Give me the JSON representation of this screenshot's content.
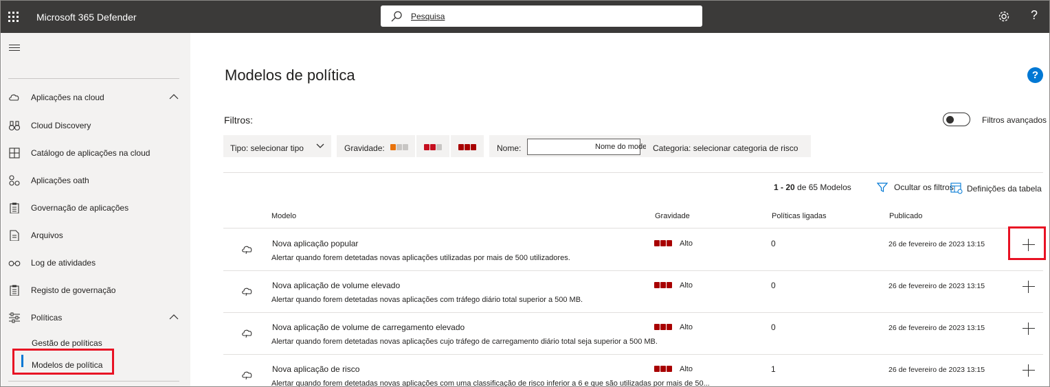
{
  "app": {
    "title": "Microsoft 365 Defender",
    "search_placeholder": "Pesquisa"
  },
  "sidebar": {
    "items": [
      {
        "label": "Aplicações na cloud",
        "icon": "cloud-icon"
      },
      {
        "label": "Cloud Discovery",
        "icon": "binoculars-icon"
      },
      {
        "label": "Catálogo de aplicações na cloud",
        "icon": "catalog-icon"
      },
      {
        "label": "Aplicações oath",
        "icon": "oauth-apps-icon"
      },
      {
        "label": "Governação de aplicações",
        "icon": "clipboard-icon"
      },
      {
        "label": "Arquivos",
        "icon": "document-icon"
      },
      {
        "label": "Log de atividades",
        "icon": "glasses-icon"
      },
      {
        "label": "Registo de governação",
        "icon": "clipboard-icon"
      },
      {
        "label": "Políticas",
        "icon": "sliders-icon"
      }
    ],
    "sub_items": [
      {
        "label": "Gestão de políticas"
      },
      {
        "label": "Modelos de política"
      }
    ]
  },
  "main": {
    "title": "Modelos de política",
    "filters_label": "Filtros:",
    "advanced_filters_label": "Filtros avançados",
    "filter_type": "Tipo: selecionar tipo",
    "filter_severity": "Gravidade:",
    "filter_name": "Nome:",
    "filter_name_placeholder": "Nome do modelo",
    "filter_category": "Categoria: selecionar categoria de risco",
    "count_range": "1 - 20",
    "count_suffix": " de 65 Modelos",
    "hide_filters": "Ocultar os filtros",
    "table_settings": "Definições da tabela",
    "columns": [
      "Modelo",
      "Gravidade",
      "Políticas ligadas",
      "Publicado"
    ],
    "rows": [
      {
        "name": "Nova aplicação popular",
        "description": "Alertar quando forem detetadas novas aplicações utilizadas por mais de 500 utilizadores.",
        "severity": "Alto",
        "linked": "0",
        "published": "26 de fevereiro de 2023 13:15"
      },
      {
        "name": "Nova aplicação de volume elevado",
        "description": "Alertar quando forem detetadas novas aplicações com tráfego diário total superior a 500 MB.",
        "severity": "Alto",
        "linked": "0",
        "published": "26 de fevereiro de 2023 13:15"
      },
      {
        "name": "Nova aplicação de volume de carregamento elevado",
        "description": "Alertar quando forem detetadas novas aplicações cujo tráfego de carregamento diário total seja superior a 500 MB.",
        "severity": "Alto",
        "linked": "0",
        "published": "26 de fevereiro de 2023 13:15"
      },
      {
        "name": "Nova aplicação de risco",
        "description": "Alertar quando forem detetadas novas aplicações com uma classificação de risco inferior a 6 e que são utilizadas por mais de 50...",
        "severity": "Alto",
        "linked": "1",
        "published": "26 de fevereiro de 2023 13:15"
      }
    ]
  },
  "colors": {
    "topbar": "#3b3a39",
    "sidebar": "#f3f2f1",
    "accent": "#0078d4",
    "severity_high": "#a80000",
    "severity_medium": "#c50f1f",
    "severity_low": "#e8730c",
    "highlight": "#e81123"
  }
}
